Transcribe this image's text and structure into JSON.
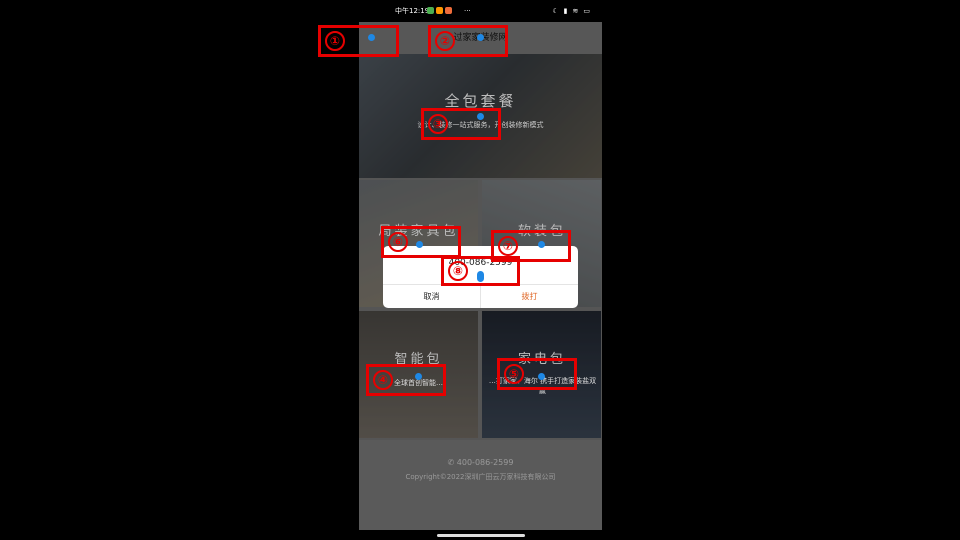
{
  "status_bar": {
    "time": "中午12:19",
    "dots": "···"
  },
  "app_bar": {
    "title": "过家家装修网"
  },
  "hero": {
    "title": "全包套餐",
    "subtitle": "设计、装修一站式服务，开创装修新模式"
  },
  "tiles": [
    {
      "title": "局装家具包",
      "subtitle": "设计…"
    },
    {
      "title": "软装包",
      "subtitle": ""
    },
    {
      "title": "智能包",
      "subtitle": "全球首创智能…"
    },
    {
      "title": "家电包",
      "subtitle": "…打家家、海尔 携手打造家装盐双赢"
    }
  ],
  "footer": {
    "phone": "400-086-2599",
    "copyright": "Copyright©2022深圳广田云万家科技有限公司"
  },
  "dialog": {
    "phone": "400-086-2599",
    "cancel": "取消",
    "call": "拨打"
  },
  "markers": [
    "①",
    "②",
    "③",
    "④",
    "⑤",
    "⑥",
    "⑦",
    "⑧"
  ],
  "colors": {
    "marker": "#e60000",
    "dot": "#1e88e5",
    "call": "#e06a2a"
  }
}
